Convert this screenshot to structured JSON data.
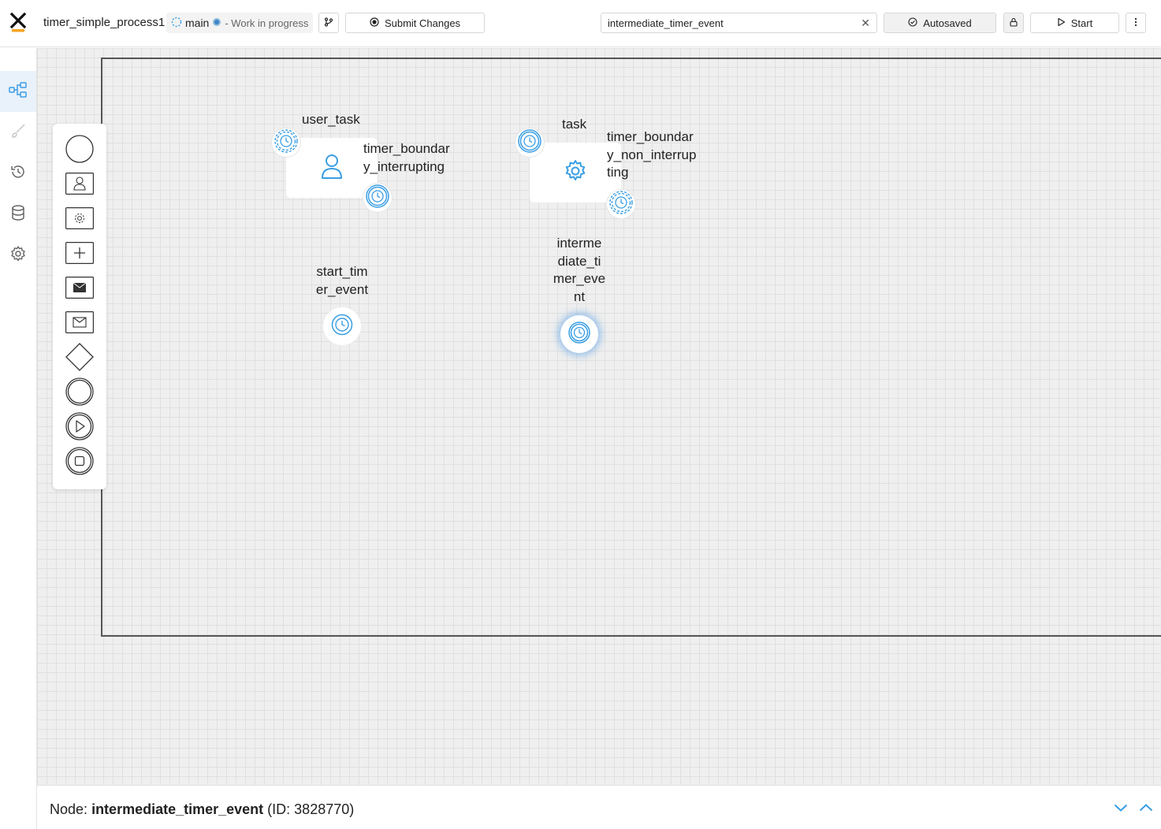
{
  "header": {
    "process_name": "timer_simple_process1",
    "branch_name": "main",
    "branch_status": "- Work in progress",
    "submit_label": "Submit Changes",
    "search_value": "intermediate_timer_event",
    "autosave_label": "Autosaved",
    "start_label": "Start"
  },
  "sidebar": {
    "items": [
      {
        "icon": "process-diagram-icon",
        "active": true
      },
      {
        "icon": "brush-icon",
        "active": false
      },
      {
        "icon": "history-icon",
        "active": false
      },
      {
        "icon": "database-icon",
        "active": false
      },
      {
        "icon": "gear-icon",
        "active": false
      }
    ]
  },
  "palette": {
    "items": [
      "start-event-icon",
      "user-task-icon",
      "service-task-icon",
      "subprocess-icon",
      "message-throw-icon",
      "message-catch-icon",
      "gateway-icon",
      "intermediate-event-icon",
      "play-event-icon",
      "end-event-icon"
    ]
  },
  "diagram": {
    "user_task_label": "user_task",
    "timer_boundary_interrupting_label": "timer_boundar\ny_interrupting",
    "task_label": "task",
    "timer_boundary_non_interrupting_label": "timer_boundar\ny_non_interrup\nting",
    "start_timer_event_label": "start_tim\ner_event",
    "intermediate_timer_event_label": "interme\ndiate_ti\nmer_eve\nnt"
  },
  "footer": {
    "node_prefix": "Node:",
    "node_name": "intermediate_timer_event",
    "node_id": "(ID: 3828770)"
  },
  "colors": {
    "accent": "#3a9ee4",
    "logo_bar": "#f5a623"
  }
}
